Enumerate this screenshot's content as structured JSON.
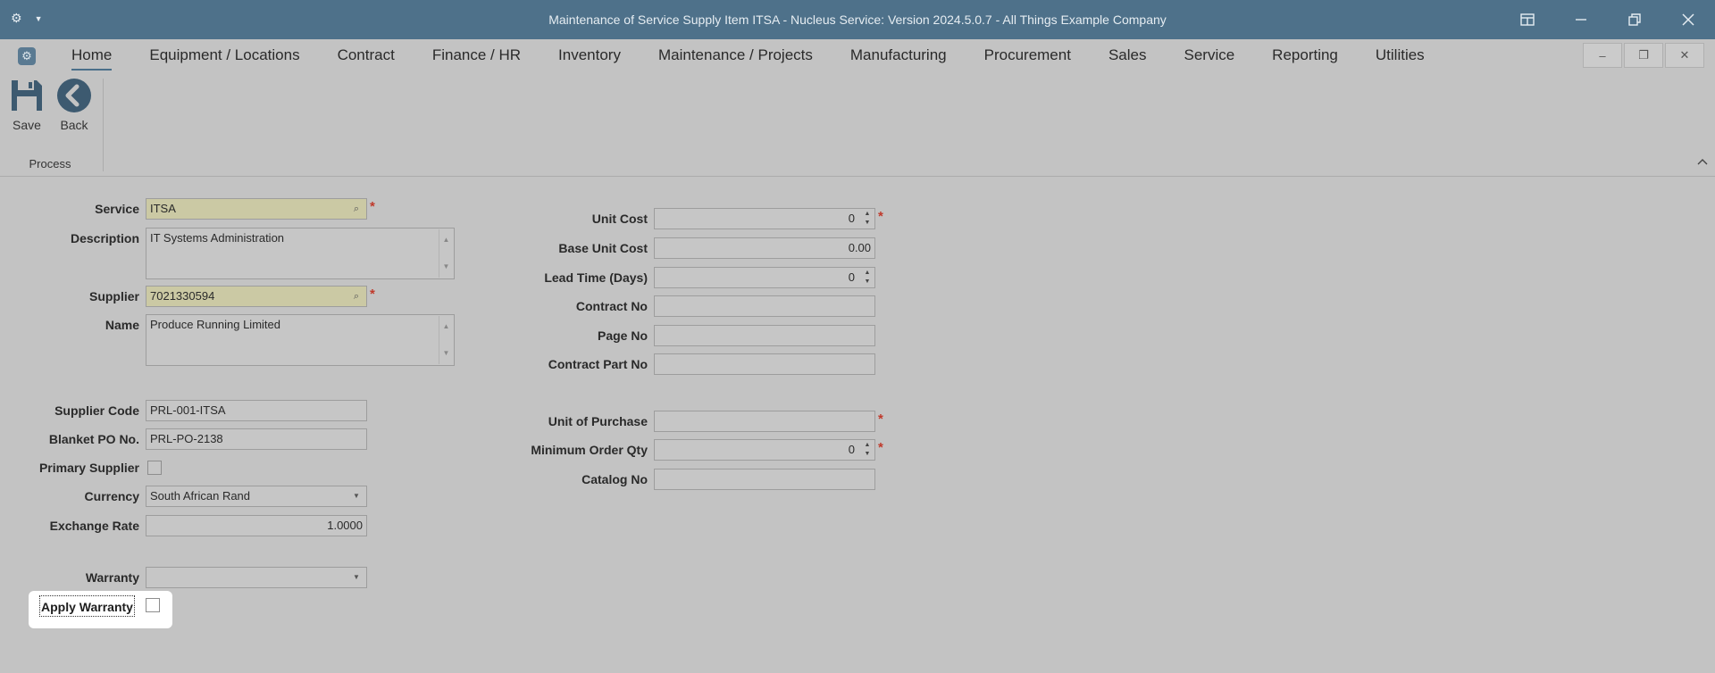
{
  "titlebar": {
    "title": "Maintenance of Service Supply Item ITSA - Nucleus Service: Version 2024.5.0.7 - All Things Example Company"
  },
  "menu": {
    "items": [
      {
        "label": "Home",
        "active": true
      },
      {
        "label": "Equipment / Locations"
      },
      {
        "label": "Contract"
      },
      {
        "label": "Finance / HR"
      },
      {
        "label": "Inventory"
      },
      {
        "label": "Maintenance / Projects"
      },
      {
        "label": "Manufacturing"
      },
      {
        "label": "Procurement"
      },
      {
        "label": "Sales"
      },
      {
        "label": "Service"
      },
      {
        "label": "Reporting"
      },
      {
        "label": "Utilities"
      }
    ]
  },
  "ribbon": {
    "save_label": "Save",
    "back_label": "Back",
    "group_label": "Process"
  },
  "form": {
    "service_label": "Service",
    "service_value": "ITSA",
    "description_label": "Description",
    "description_value": "IT Systems Administration",
    "supplier_label": "Supplier",
    "supplier_value": "7021330594",
    "name_label": "Name",
    "name_value": "Produce Running Limited",
    "supplier_code_label": "Supplier Code",
    "supplier_code_value": "PRL-001-ITSA",
    "blanket_po_label": "Blanket PO No.",
    "blanket_po_value": "PRL-PO-2138",
    "primary_supplier_label": "Primary Supplier",
    "currency_label": "Currency",
    "currency_value": "South African Rand",
    "exchange_rate_label": "Exchange Rate",
    "exchange_rate_value": "1.0000",
    "warranty_label": "Warranty",
    "warranty_value": "",
    "apply_warranty_label": "Apply Warranty",
    "unit_cost_label": "Unit Cost",
    "unit_cost_value": "0",
    "base_unit_cost_label": "Base Unit Cost",
    "base_unit_cost_value": "0.00",
    "lead_time_label": "Lead Time (Days)",
    "lead_time_value": "0",
    "contract_no_label": "Contract No",
    "contract_no_value": "",
    "page_no_label": "Page No",
    "page_no_value": "",
    "contract_part_no_label": "Contract Part No",
    "contract_part_no_value": "",
    "unit_of_purchase_label": "Unit of Purchase",
    "unit_of_purchase_value": "",
    "min_order_qty_label": "Minimum Order Qty",
    "min_order_qty_value": "0",
    "catalog_no_label": "Catalog No",
    "catalog_no_value": "",
    "required_marker": "*"
  }
}
